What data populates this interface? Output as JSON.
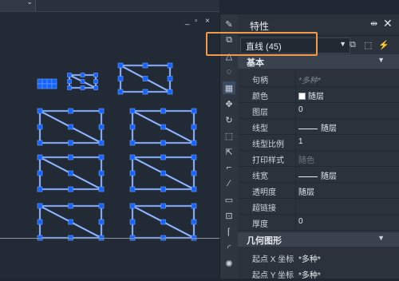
{
  "window": {
    "controls": [
      "_",
      "▫",
      "×"
    ]
  },
  "properties_panel": {
    "title": "特性",
    "pin_label": "⇹",
    "close_label": "✕",
    "selection": "直线 (45)",
    "sections": [
      {
        "name": "基本",
        "rows": [
          {
            "key": "句柄",
            "value": "*多种*"
          },
          {
            "key": "颜色",
            "value": "随层"
          },
          {
            "key": "图层",
            "value": "0"
          },
          {
            "key": "线型",
            "value": "随层"
          },
          {
            "key": "线型比例",
            "value": "1"
          },
          {
            "key": "打印样式",
            "value": "随色"
          },
          {
            "key": "线宽",
            "value": "随层"
          },
          {
            "key": "透明度",
            "value": "随层"
          },
          {
            "key": "超链接",
            "value": ""
          },
          {
            "key": "厚度",
            "value": "0"
          }
        ]
      },
      {
        "name": "几何图形",
        "rows": [
          {
            "key": "起点 X 坐标",
            "value": "*多种*"
          },
          {
            "key": "起点 Y 坐标",
            "value": "*多种*"
          }
        ]
      }
    ]
  },
  "colors": {
    "accent_highlight": "#f2994a",
    "grip_blue": "#1463ff",
    "line_white": "#d7e6ff"
  }
}
